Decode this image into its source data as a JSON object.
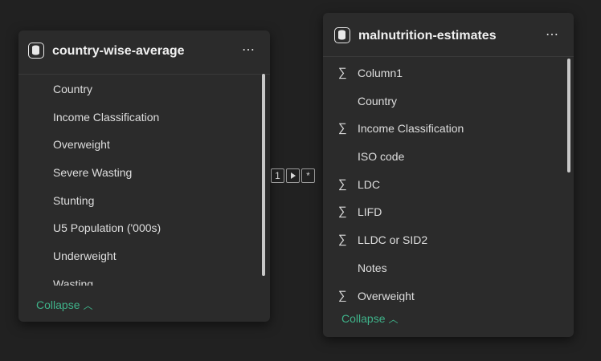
{
  "left_table": {
    "title": "country-wise-average",
    "more": "⋯",
    "fields": [
      {
        "label": "Country",
        "aggregated": false
      },
      {
        "label": "Income Classification",
        "aggregated": false
      },
      {
        "label": "Overweight",
        "aggregated": false
      },
      {
        "label": "Severe Wasting",
        "aggregated": false
      },
      {
        "label": "Stunting",
        "aggregated": false
      },
      {
        "label": "U5 Population ('000s)",
        "aggregated": false
      },
      {
        "label": "Underweight",
        "aggregated": false
      },
      {
        "label": "Wasting",
        "aggregated": false
      }
    ],
    "collapse_label": "Collapse"
  },
  "right_table": {
    "title": "malnutrition-estimates",
    "more": "⋯",
    "fields": [
      {
        "label": "Column1",
        "aggregated": true
      },
      {
        "label": "Country",
        "aggregated": false
      },
      {
        "label": "Income Classification",
        "aggregated": true
      },
      {
        "label": "ISO code",
        "aggregated": false
      },
      {
        "label": "LDC",
        "aggregated": true
      },
      {
        "label": "LIFD",
        "aggregated": true
      },
      {
        "label": "LLDC or SID2",
        "aggregated": true
      },
      {
        "label": "Notes",
        "aggregated": false
      },
      {
        "label": "Overweight",
        "aggregated": true
      }
    ],
    "collapse_label": "Collapse"
  },
  "relationship": {
    "left_cardinality": "1",
    "right_cardinality": "*",
    "direction": "single"
  },
  "colors": {
    "background": "#212121",
    "card": "#2b2b2b",
    "accent": "#3fb38a"
  }
}
